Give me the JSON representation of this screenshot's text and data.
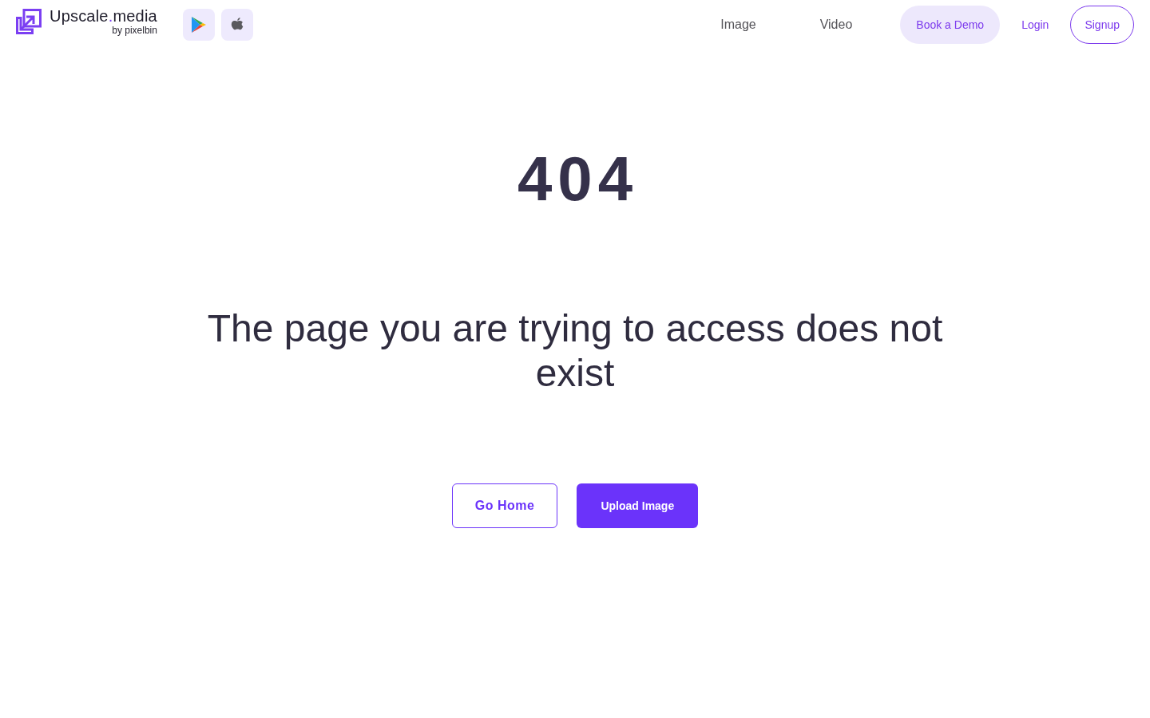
{
  "header": {
    "logo": {
      "wordmark": [
        {
          "text": "Upscale",
          "accent": false
        },
        {
          "text": ".",
          "accent": true
        },
        {
          "text": "media",
          "accent": false
        }
      ],
      "byline": "by pixelbin"
    },
    "app_stores": [
      {
        "kind": "play"
      },
      {
        "kind": "apple"
      }
    ],
    "nav": [
      {
        "label": "Image",
        "kind": "plain"
      },
      {
        "label": "Video",
        "kind": "plain"
      },
      {
        "label": "Book a Demo",
        "kind": "filled"
      },
      {
        "label": "Login",
        "kind": "link"
      },
      {
        "label": "Signup",
        "kind": "outline"
      }
    ]
  },
  "error": {
    "code": "404",
    "message": "The page you are trying to access does not exist",
    "buttons": [
      {
        "label": "Go Home",
        "kind": "outline"
      },
      {
        "label": "Upload Image",
        "kind": "filled"
      }
    ]
  }
}
